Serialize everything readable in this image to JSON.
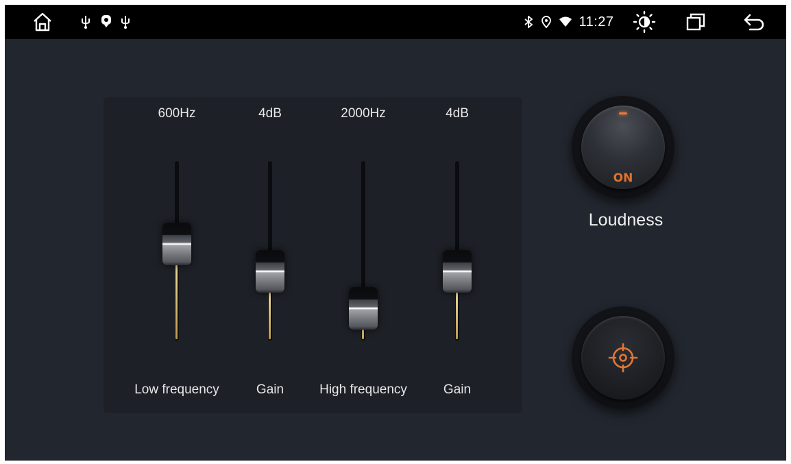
{
  "statusbar": {
    "time": "11:27",
    "left_icons": [
      "home-icon",
      "usb-icon",
      "location-pin-icon",
      "usb-icon"
    ],
    "right_icons": [
      "bluetooth-icon",
      "location-icon",
      "wifi-icon",
      "brightness-icon",
      "recent-apps-icon",
      "back-icon"
    ]
  },
  "equalizer": {
    "bands": [
      {
        "value": "600Hz",
        "label": "Low frequency",
        "level": 0.55
      },
      {
        "value": "4dB",
        "label": "Gain",
        "level": 0.35
      },
      {
        "value": "2000Hz",
        "label": "High frequency",
        "level": 0.08
      },
      {
        "value": "4dB",
        "label": "Gain",
        "level": 0.35
      }
    ]
  },
  "loudness": {
    "state": "ON",
    "label": "Loudness"
  },
  "sound_field": {
    "icon": "crosshair-icon"
  },
  "colors": {
    "background": "#22262e",
    "panel": "#1d2027",
    "accent": "#e2712c",
    "slider_fill": "#d4b46a"
  }
}
